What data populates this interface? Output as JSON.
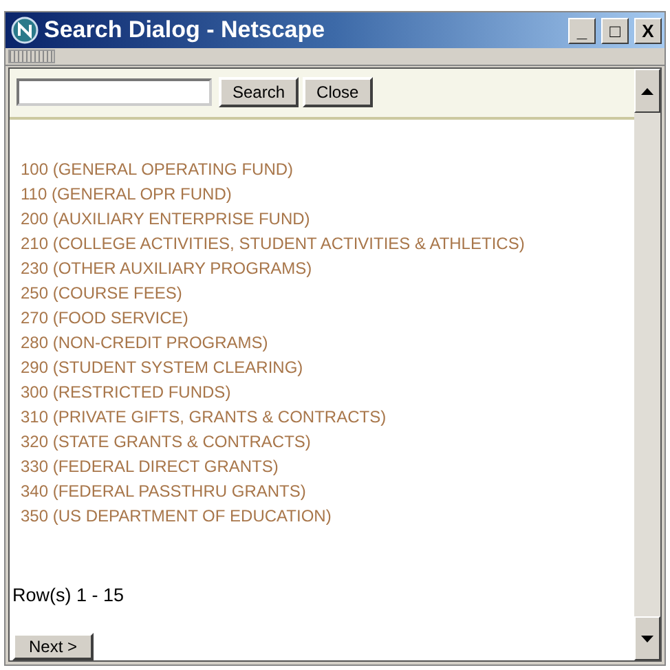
{
  "window": {
    "title": "Search Dialog - Netscape",
    "controls": [
      "_",
      "□",
      "X"
    ]
  },
  "search": {
    "buttons": [
      "Search",
      "Close"
    ]
  },
  "results": [
    "100 (GENERAL OPERATING FUND)",
    "110 (GENERAL OPR FUND)",
    "200 (AUXILIARY ENTERPRISE FUND)",
    "210 (COLLEGE ACTIVITIES, STUDENT ACTIVITIES & ATHLETICS)",
    "230 (OTHER AUXILIARY PROGRAMS)",
    "250 (COURSE FEES)",
    "270 (FOOD SERVICE)",
    "280 (NON-CREDIT PROGRAMS)",
    "290 (STUDENT SYSTEM CLEARING)",
    "300 (RESTRICTED FUNDS)",
    "310 (PRIVATE GIFTS, GRANTS & CONTRACTS)",
    "320 (STATE GRANTS & CONTRACTS)",
    "330 (FEDERAL DIRECT GRANTS)",
    "340 (FEDERAL PASSTHRU GRANTS)",
    "350 (US DEPARTMENT OF EDUCATION)"
  ],
  "row_count": "Row(s) 1 - 15",
  "next_button": "Next >"
}
